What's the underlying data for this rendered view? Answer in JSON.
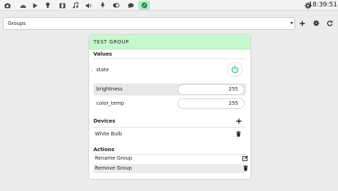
{
  "toolbar": {
    "icons": [
      "camera-icon",
      "android-icon",
      "play-icon",
      "lightbulb-icon",
      "film-icon",
      "music-icon",
      "volume-icon",
      "microphone-icon",
      "toggle-icon",
      "chat-icon",
      "leaf-icon"
    ],
    "active_icon": "leaf-icon",
    "time": "18:39:51"
  },
  "selector": {
    "selected": "Groups",
    "buttons": [
      "add-icon",
      "gear-icon",
      "refresh-icon"
    ]
  },
  "group": {
    "title": "TEST GROUP",
    "header_color": "#c6f7ce",
    "values_title": "Values",
    "state_label": "state",
    "state_power_color": "#3ecf8e",
    "brightness_label": "brightness",
    "brightness_value": "255",
    "color_temp_label": "color_temp",
    "color_temp_value": "255",
    "devices_title": "Devices",
    "devices": [
      "White Bulb"
    ],
    "actions_title": "Actions",
    "actions": [
      "Rename Group",
      "Remove Group"
    ]
  }
}
